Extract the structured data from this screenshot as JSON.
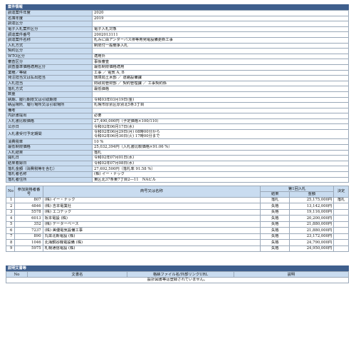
{
  "section_title": "案件情報",
  "info_rows": [
    {
      "label": "調達案件年度",
      "value": "2020"
    },
    {
      "label": "名簿年度",
      "value": "2019"
    },
    {
      "label": "調達区分",
      "value": ""
    },
    {
      "label": "電子入札案件区分",
      "value": "電子入札対象"
    },
    {
      "label": "調達案件番号",
      "value": "2002013111"
    },
    {
      "label": "調達案件名称",
      "value": "札みに由アンダーパス排等用発電設備更新工事"
    },
    {
      "label": "入札方式",
      "value": "制限付一般競争入札"
    },
    {
      "label": "契約区分",
      "value": ""
    },
    {
      "label": "WTO区分",
      "value": "適用外"
    },
    {
      "label": "審査区分",
      "value": "事後審査"
    },
    {
      "label": "調査基準価格適用区分",
      "value": "最低制限価格適用"
    },
    {
      "label": "業種／等級",
      "value": "工事 ／ 電気 A, B"
    },
    {
      "label": "発注担当又は払出担当",
      "value": "環境局土木部 ／ 道路設備課"
    },
    {
      "label": "入札担当",
      "value": "財政局管財部 ／ 契約管理課 ／ 工事契約係"
    },
    {
      "label": "落札方式",
      "value": "最低価格"
    },
    {
      "label": "数量",
      "value": ""
    },
    {
      "label": "納期、履行期限又は引取期限",
      "value": "令和03年03月19日(金)"
    },
    {
      "label": "納品場所、履行場所又は引取場所",
      "value": "札幌市厚別区厚別北5条3丁目"
    },
    {
      "label": "備考",
      "value": ""
    },
    {
      "label": "内訳書提出",
      "value": "必要"
    },
    {
      "label": "入札書比較価格",
      "value": "27,490,000円（予定価格×100/110）"
    },
    {
      "label": "公示日",
      "value": "令和02年06月17日(水)"
    },
    {
      "label": "入札書受付予定期間",
      "value": "令和02年06月29日(月) 08時00分から",
      "value2": "令和02年06月30日(火) 17時00分まで"
    },
    {
      "label": "消費税率",
      "value": "10 %"
    },
    {
      "label": "最低制限価格",
      "value": "25,032,394円（入札書比較価格×91.06 %）"
    },
    {
      "label": "入札結果",
      "value": "落札"
    },
    {
      "label": "開札日",
      "value": "令和02年07月01日(水)"
    },
    {
      "label": "結果着録日",
      "value": "令和02年07月08日(水)"
    },
    {
      "label": "落札金額（消費税等を含む）",
      "value": "27,692,500円（落札率 91.58 %）"
    },
    {
      "label": "落札者名称",
      "value": "(株) イー・ナック"
    },
    {
      "label": "落札者住所",
      "value": "東区北37条東7丁目2―11　NAビル"
    }
  ],
  "result_headers": {
    "no": "No",
    "bidder_no": "参加資格者番号",
    "name": "商号又は名称",
    "round": "第1回入札",
    "status": "結果",
    "amount": "金額",
    "decision": "決定"
  },
  "bidders": [
    {
      "no": "1",
      "bidder_no": "807",
      "name": "(株) イー・ナック",
      "status": "落札",
      "amount": "25,175,000円",
      "decision": "落札"
    },
    {
      "no": "2",
      "bidder_no": "4846",
      "name": "(株) 吉本電業社",
      "status": "失格",
      "amount": "13,142,000円",
      "decision": ""
    },
    {
      "no": "3",
      "bidder_no": "5578",
      "name": "(株) エコテック",
      "status": "失格",
      "amount": "19,116,000円",
      "decision": ""
    },
    {
      "no": "4",
      "bidder_no": "6013",
      "name": "坂本電設 (株)",
      "status": "失格",
      "amount": "20,200,000円",
      "decision": ""
    },
    {
      "no": "5",
      "bidder_no": "352",
      "name": "(株) データーベース",
      "status": "失格",
      "amount": "21,880,000円",
      "decision": ""
    },
    {
      "no": "6",
      "bidder_no": "7237",
      "name": "(株) 美優電気設備工事",
      "status": "失格",
      "amount": "21,880,000円",
      "decision": ""
    },
    {
      "no": "7",
      "bidder_no": "890",
      "name": "丸栄北新電設 (株)",
      "status": "失格",
      "amount": "23,172,000円",
      "decision": ""
    },
    {
      "no": "8",
      "bidder_no": "1046",
      "name": "北海鋼谷機電設備 (株)",
      "status": "失格",
      "amount": "24,790,000円",
      "decision": ""
    },
    {
      "no": "9",
      "bidder_no": "5975",
      "name": "札幌通信電設 (株)",
      "status": "失格",
      "amount": "24,950,000円",
      "decision": ""
    }
  ],
  "doc_section_title": "説明文書等",
  "doc_headers": {
    "no": "No",
    "doc_name": "文書名",
    "file_link": "格納ファイル名/外部リンクURL",
    "desc": "説明"
  },
  "doc_empty": "設計図書等は登録されていません。"
}
